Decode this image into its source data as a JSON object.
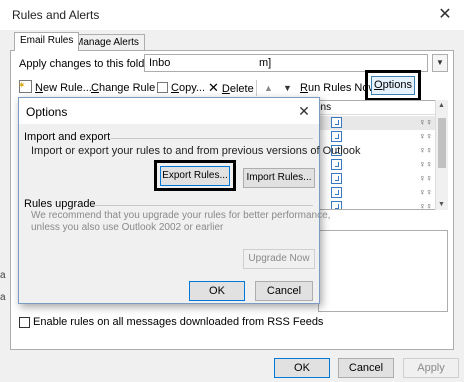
{
  "window": {
    "title": "Rules and Alerts",
    "close_icon": "close-icon"
  },
  "tabs": [
    {
      "label": "Email Rules",
      "active": true
    },
    {
      "label": "Manage Alerts",
      "active": false
    }
  ],
  "folder": {
    "label": "Apply changes to this folder:",
    "value_start": "Inbo",
    "value_end": "m]"
  },
  "toolbar": {
    "new_rule": "ew Rule...",
    "new_rule_key": "N",
    "change_rule": "hange Rule",
    "change_rule_key": "C",
    "copy": "opy...",
    "copy_key": "C",
    "delete": "elete",
    "delete_key": "D",
    "run_rules": "un Rules Now...",
    "run_rules_key": "R",
    "options": "ptions",
    "options_key": "O"
  },
  "rules_list": {
    "header": "ons",
    "rows": 7
  },
  "rss": {
    "label": "Enable rules on all messages downloaded from RSS Feeds",
    "checked": false
  },
  "footer": {
    "ok": "OK",
    "cancel": "Cancel",
    "apply": "Apply"
  },
  "options_dialog": {
    "title": "Options",
    "import_export": {
      "title": "Import and export",
      "description": "Import or export your rules to and from previous versions of Outlook",
      "export_button": "Export Rules...",
      "import_button": "Import Rules..."
    },
    "upgrade": {
      "title": "Rules upgrade",
      "description_line1": "We recommend that you upgrade your rules for better performance,",
      "description_line2": "unless you also use Outlook 2002 or earlier",
      "upgrade_button": "Upgrade Now"
    },
    "ok": "OK",
    "cancel": "Cancel"
  },
  "colors": {
    "highlight_border": "#000000",
    "accent": "#0078d7",
    "dialog_border": "#7a9cc4"
  }
}
